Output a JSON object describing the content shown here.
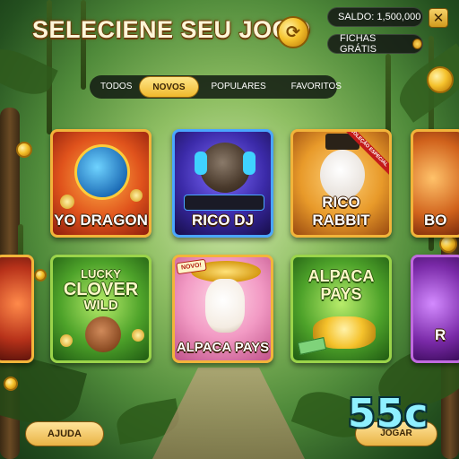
{
  "header": {
    "title": "SELECIENE SEU JOGO",
    "title_icon": "refresh-coin-icon",
    "balance_label": "SALDO: 1,500,000",
    "chips_label": "FICHAS GRÁTIS",
    "close_label": "✕"
  },
  "tabs": [
    {
      "label": "TODOS",
      "active": false
    },
    {
      "label": "NOVOS",
      "active": true
    },
    {
      "label": "POPULARES",
      "active": false
    },
    {
      "label": "FAVORITOS",
      "active": false
    }
  ],
  "games": {
    "yo_dragon": {
      "label": "YO DRAGON"
    },
    "rico_dj": {
      "label": "RICO DJ"
    },
    "rico_rabbit": {
      "label": "RICO RABBIT",
      "ribbon": "COLEÇÃO ESPECIAL"
    },
    "partial_top": {
      "label": "BO"
    },
    "lucky_clover": {
      "line1": "LUCKY",
      "line2": "CLOVER",
      "line3": "WILD"
    },
    "alpaca_pays": {
      "label": "ALPACA PAYS",
      "badge": "NOVO!"
    },
    "alpaca_pays_green": {
      "line1": "ALPACA",
      "line2": "PAYS"
    },
    "partial_bottom": {
      "label": "R"
    }
  },
  "footer": {
    "help_label": "AJUDA",
    "right_button_label": "JOGAR",
    "price": "55c"
  },
  "colors": {
    "gold": "#f0b92c",
    "dark_panel": "#141814",
    "price_text": "#8ff0ff"
  }
}
